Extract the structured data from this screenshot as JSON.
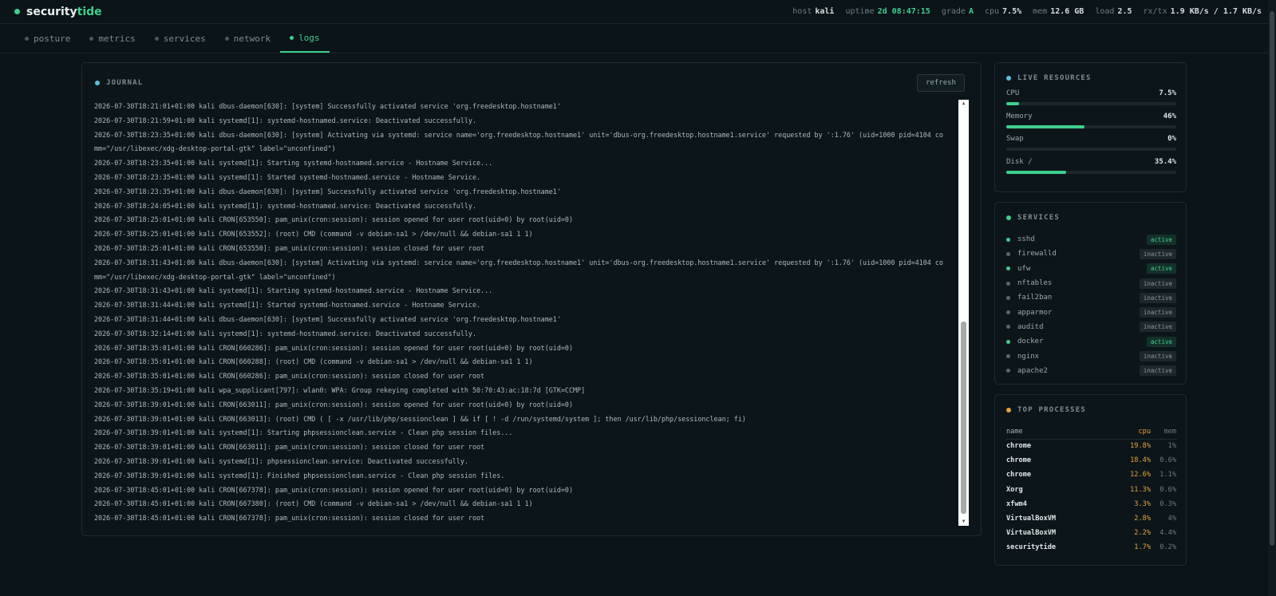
{
  "brand": {
    "prefix": "security",
    "accent": "tide"
  },
  "stats": {
    "host_label": "host",
    "host": "kali",
    "uptime_label": "uptime",
    "uptime": "2d 08:47:15",
    "grade_label": "grade",
    "grade": "A",
    "cpu_label": "cpu",
    "cpu": "7.5%",
    "mem_label": "mem",
    "mem": "12.6 GB",
    "load_label": "load",
    "load": "2.5",
    "rxtx_label": "rx/tx",
    "rxtx": "1.9 KB/s / 1.7 KB/s"
  },
  "tabs": [
    {
      "label": "posture",
      "active": false
    },
    {
      "label": "metrics",
      "active": false
    },
    {
      "label": "services",
      "active": false
    },
    {
      "label": "network",
      "active": false
    },
    {
      "label": "logs",
      "active": true
    }
  ],
  "journal": {
    "title": "JOURNAL",
    "refresh_label": "refresh",
    "lines": [
      "2026-07-30T18:21:01+01:00 kali dbus-daemon[630]: [system] Successfully activated service 'org.freedesktop.hostname1'",
      "2026-07-30T18:21:59+01:00 kali systemd[1]: systemd-hostnamed.service: Deactivated successfully.",
      "2026-07-30T18:23:35+01:00 kali dbus-daemon[630]: [system] Activating via systemd: service name='org.freedesktop.hostname1' unit='dbus-org.freedesktop.hostname1.service' requested by ':1.76' (uid=1000 pid=4104 comm=\"/usr/libexec/xdg-desktop-portal-gtk\" label=\"unconfined\")",
      "2026-07-30T18:23:35+01:00 kali systemd[1]: Starting systemd-hostnamed.service - Hostname Service...",
      "2026-07-30T18:23:35+01:00 kali systemd[1]: Started systemd-hostnamed.service - Hostname Service.",
      "2026-07-30T18:23:35+01:00 kali dbus-daemon[630]: [system] Successfully activated service 'org.freedesktop.hostname1'",
      "2026-07-30T18:24:05+01:00 kali systemd[1]: systemd-hostnamed.service: Deactivated successfully.",
      "2026-07-30T18:25:01+01:00 kali CRON[653550]: pam_unix(cron:session): session opened for user root(uid=0) by root(uid=0)",
      "2026-07-30T18:25:01+01:00 kali CRON[653552]: (root) CMD (command -v debian-sa1 > /dev/null && debian-sa1 1 1)",
      "2026-07-30T18:25:01+01:00 kali CRON[653550]: pam_unix(cron:session): session closed for user root",
      "2026-07-30T18:31:43+01:00 kali dbus-daemon[630]: [system] Activating via systemd: service name='org.freedesktop.hostname1' unit='dbus-org.freedesktop.hostname1.service' requested by ':1.76' (uid=1000 pid=4104 comm=\"/usr/libexec/xdg-desktop-portal-gtk\" label=\"unconfined\")",
      "2026-07-30T18:31:43+01:00 kali systemd[1]: Starting systemd-hostnamed.service - Hostname Service...",
      "2026-07-30T18:31:44+01:00 kali systemd[1]: Started systemd-hostnamed.service - Hostname Service.",
      "2026-07-30T18:31:44+01:00 kali dbus-daemon[630]: [system] Successfully activated service 'org.freedesktop.hostname1'",
      "2026-07-30T18:32:14+01:00 kali systemd[1]: systemd-hostnamed.service: Deactivated successfully.",
      "2026-07-30T18:35:01+01:00 kali CRON[660286]: pam_unix(cron:session): session opened for user root(uid=0) by root(uid=0)",
      "2026-07-30T18:35:01+01:00 kali CRON[660288]: (root) CMD (command -v debian-sa1 > /dev/null && debian-sa1 1 1)",
      "2026-07-30T18:35:01+01:00 kali CRON[660286]: pam_unix(cron:session): session closed for user root",
      "2026-07-30T18:35:19+01:00 kali wpa_supplicant[797]: wlan0: WPA: Group rekeying completed with 50:70:43:ac:18:7d [GTK=CCMP]",
      "2026-07-30T18:39:01+01:00 kali CRON[663011]: pam_unix(cron:session): session opened for user root(uid=0) by root(uid=0)",
      "2026-07-30T18:39:01+01:00 kali CRON[663013]: (root) CMD ( [ -x /usr/lib/php/sessionclean ] && if [ ! -d /run/systemd/system ]; then /usr/lib/php/sessionclean; fi)",
      "2026-07-30T18:39:01+01:00 kali systemd[1]: Starting phpsessionclean.service - Clean php session files...",
      "2026-07-30T18:39:01+01:00 kali CRON[663011]: pam_unix(cron:session): session closed for user root",
      "2026-07-30T18:39:01+01:00 kali systemd[1]: phpsessionclean.service: Deactivated successfully.",
      "2026-07-30T18:39:01+01:00 kali systemd[1]: Finished phpsessionclean.service - Clean php session files.",
      "2026-07-30T18:45:01+01:00 kali CRON[667378]: pam_unix(cron:session): session opened for user root(uid=0) by root(uid=0)",
      "2026-07-30T18:45:01+01:00 kali CRON[667380]: (root) CMD (command -v debian-sa1 > /dev/null && debian-sa1 1 1)",
      "2026-07-30T18:45:01+01:00 kali CRON[667378]: pam_unix(cron:session): session closed for user root"
    ]
  },
  "resources": {
    "title": "LIVE RESOURCES",
    "items": [
      {
        "label": "CPU",
        "value": "7.5%",
        "percent": 7.5
      },
      {
        "label": "Memory",
        "value": "46%",
        "percent": 46
      },
      {
        "label": "Swap",
        "value": "0%",
        "percent": 0
      },
      {
        "label": "Disk /",
        "value": "35.4%",
        "percent": 35.4
      }
    ]
  },
  "services": {
    "title": "SERVICES",
    "items": [
      {
        "name": "sshd",
        "status": "active"
      },
      {
        "name": "firewalld",
        "status": "inactive"
      },
      {
        "name": "ufw",
        "status": "active"
      },
      {
        "name": "nftables",
        "status": "inactive"
      },
      {
        "name": "fail2ban",
        "status": "inactive"
      },
      {
        "name": "apparmor",
        "status": "inactive"
      },
      {
        "name": "auditd",
        "status": "inactive"
      },
      {
        "name": "docker",
        "status": "active"
      },
      {
        "name": "nginx",
        "status": "inactive"
      },
      {
        "name": "apache2",
        "status": "inactive"
      }
    ]
  },
  "processes": {
    "title": "TOP PROCESSES",
    "headers": {
      "name": "name",
      "cpu": "cpu",
      "mem": "mem"
    },
    "rows": [
      {
        "name": "chrome",
        "cpu": "19.8%",
        "mem": "1%"
      },
      {
        "name": "chrome",
        "cpu": "18.4%",
        "mem": "0.6%"
      },
      {
        "name": "chrome",
        "cpu": "12.6%",
        "mem": "1.1%"
      },
      {
        "name": "Xorg",
        "cpu": "11.3%",
        "mem": "0.6%"
      },
      {
        "name": "xfwm4",
        "cpu": "3.3%",
        "mem": "0.3%"
      },
      {
        "name": "VirtualBoxVM",
        "cpu": "2.8%",
        "mem": "4%"
      },
      {
        "name": "VirtualBoxVM",
        "cpu": "2.2%",
        "mem": "4.4%"
      },
      {
        "name": "securitytide",
        "cpu": "1.7%",
        "mem": "0.2%"
      }
    ]
  },
  "colors": {
    "accent": "#3fcf8e",
    "warn": "#e6a23c",
    "info": "#5bc0de",
    "bg": "#0b1418"
  }
}
